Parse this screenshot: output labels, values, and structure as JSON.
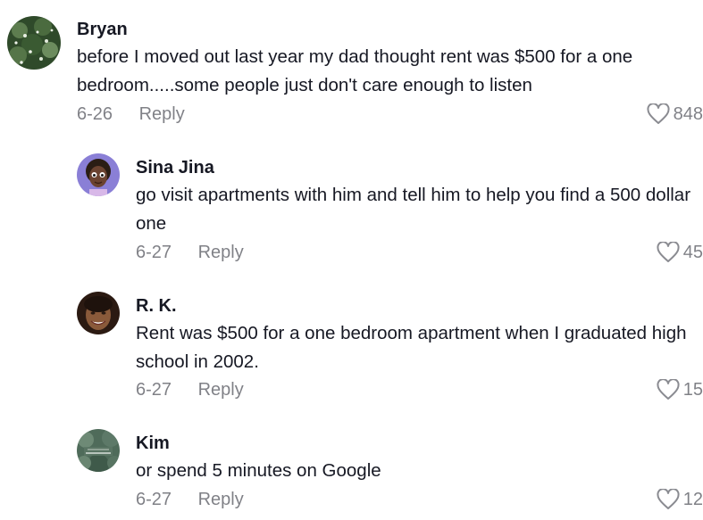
{
  "comments": [
    {
      "username": "Bryan",
      "text": "before I moved out last year my dad thought rent was $500 for a one bedroom.....some people just don't care enough to listen",
      "date": "6-26",
      "reply_label": "Reply",
      "likes": "848"
    },
    {
      "username": "Sina Jina",
      "text": "go visit apartments with him and tell him to help you find a 500 dollar one",
      "date": "6-27",
      "reply_label": "Reply",
      "likes": "45"
    },
    {
      "username": "R. K.",
      "text": "Rent was $500 for a one bedroom apartment when I graduated high school in 2002.",
      "date": "6-27",
      "reply_label": "Reply",
      "likes": "15"
    },
    {
      "username": "Kim",
      "text": "or spend 5 minutes on Google",
      "date": "6-27",
      "reply_label": "Reply",
      "likes": "12"
    }
  ],
  "icons": {
    "like": "heart-outline-icon"
  },
  "colors": {
    "text": "#161823",
    "secondary": "#8a8b91"
  }
}
